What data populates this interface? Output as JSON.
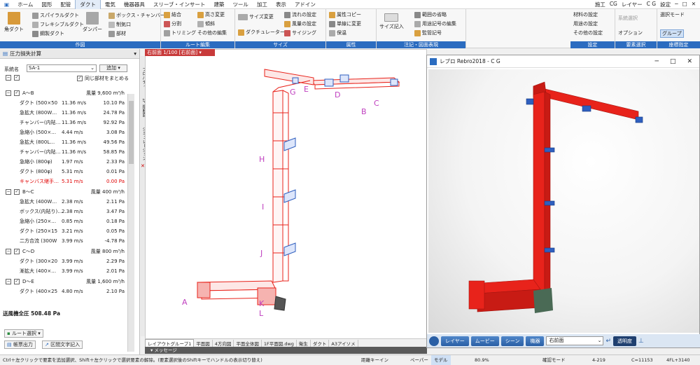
{
  "tabs": [
    "ホーム",
    "図形",
    "配管",
    "ダクト",
    "電気",
    "機器器具",
    "スリーブ・インサート",
    "建築",
    "ツール",
    "加工",
    "表示",
    "アドイン"
  ],
  "tabs_active": "ダクト",
  "tabs_right": [
    "施工",
    "CG",
    "レイヤー",
    "C G",
    "設定"
  ],
  "ribbon": {
    "groups": [
      {
        "caption": "作図",
        "items": [
          "角ダクト",
          "スパイラルダクト",
          "フレキシブルダクト",
          "鋼製ダクト",
          "ダンパー",
          "ボックス・チャンバー",
          "制気口",
          "部材"
        ]
      },
      {
        "caption": "ルート編集",
        "items": [
          "結合",
          "分割",
          "トリミング",
          "高さ変更",
          "傾斜",
          "その他の編集"
        ]
      },
      {
        "caption": "サイズ",
        "items": [
          "サイズ変更",
          "ダクチュレーター",
          "流れの設定",
          "風量の設定",
          "サイジング"
        ]
      },
      {
        "caption": "属性",
        "items": [
          "属性コピー",
          "単線に変更",
          "保温"
        ]
      },
      {
        "caption": "注記・図面表現",
        "items": [
          "サイズ記入",
          "範囲の省略",
          "用途記号の編集",
          "監管記号"
        ]
      },
      {
        "caption": "設定",
        "items": [
          "材料の設定",
          "用途の設定",
          "その他の設定"
        ]
      },
      {
        "caption": "要素選択",
        "items": [
          "系統選択",
          "オプション"
        ]
      },
      {
        "caption": "座標指定",
        "items": [
          "選択モード",
          "グループ"
        ]
      }
    ]
  },
  "panel": {
    "title": "圧力損失計算",
    "system_label": "系統名",
    "system_value": "SA-1",
    "add_button": "追加",
    "merge_label": "同じ部材をまとめる",
    "groups": [
      {
        "title": "A～B",
        "flow": "風量 9,600 m³/h",
        "rows": [
          [
            "ダクト (500×50",
            "11.36 m/s",
            "10.10 Pa",
            ""
          ],
          [
            "急拡大 (800W…",
            "11.36 m/s",
            "24.78 Pa",
            ""
          ],
          [
            "チャンバー(内貼…",
            "11.36 m/s",
            "92.92 Pa",
            ""
          ],
          [
            "急縮小 (500×…",
            "4.44 m/s",
            "3.08 Pa",
            ""
          ],
          [
            "急拡大 (800L…",
            "11.36 m/s",
            "49.56 Pa",
            ""
          ],
          [
            "チャンバー(内貼…",
            "11.36 m/s",
            "58.85 Pa",
            ""
          ],
          [
            "急縮小 (800φ)",
            "1.97 m/s",
            "2.33 Pa",
            ""
          ],
          [
            "ダクト (800φ)",
            "5.31 m/s",
            "0.01 Pa",
            ""
          ],
          [
            "キャンバス継手…",
            "5.31 m/s",
            "0.00 Pa",
            "red"
          ]
        ]
      },
      {
        "title": "B～C",
        "flow": "風量 400 m³/h",
        "rows": [
          [
            "急拡大 (400W…",
            "2.38 m/s",
            "2.11 Pa",
            ""
          ],
          [
            "ボックス(内貼り)…",
            "2.38 m/s",
            "3.47 Pa",
            ""
          ],
          [
            "急縮小 (250×…",
            "0.85 m/s",
            "0.18 Pa",
            ""
          ],
          [
            "ダクト (250×15",
            "3.21 m/s",
            "0.05 Pa",
            ""
          ],
          [
            "二方合流 (300W",
            "3.99 m/s",
            "-4.78 Pa",
            ""
          ]
        ]
      },
      {
        "title": "C～D",
        "flow": "風量 800 m³/h",
        "rows": [
          [
            "ダクト (300×20",
            "3.99 m/s",
            "2.29 Pa",
            ""
          ],
          [
            "漸拡大 (400×…",
            "3.99 m/s",
            "2.01 Pa",
            ""
          ]
        ]
      },
      {
        "title": "D～E",
        "flow": "風量 1,600 m³/h",
        "rows": [
          [
            "ダクト (400×25",
            "4.80 m/s",
            "2.10 Pa",
            ""
          ]
        ]
      }
    ],
    "total": "送風機全圧 508.48 Pa",
    "route_select": "ルート選択",
    "report_button": "帳票出力",
    "section_text_button": "区間文字記入"
  },
  "viewport": {
    "tab_label": "右前面 1/100 [右前面]",
    "side_tabs": [
      "プロパティ",
      "1F 縦断面",
      "ジミュレーション"
    ],
    "labels": [
      "A",
      "B",
      "C",
      "D",
      "E",
      "G",
      "H",
      "I",
      "J",
      "K",
      "L"
    ],
    "bottom_tabs": [
      "レイアウトグループ1",
      "平面図",
      "4方向図",
      "平面全体図",
      "1F平面図.dwg",
      "衛生",
      "ダクト",
      "A3アイソメ"
    ],
    "message_label": "メッセージ"
  },
  "rebro": {
    "title": "レブロ Rebro2018 - C G",
    "buttons": [
      "レイヤー",
      "ムービー",
      "シーン",
      "機器"
    ],
    "view_select": "右前面",
    "transparency": "透明度"
  },
  "status": {
    "hint": "Ctrl＋左クリックで要素を追加選択、Shift＋左クリックで選択要素の解除。(要素選択後のShiftキーでハンドルの表示切り替え)",
    "distance_key": "距離キーイン",
    "paper": "ペーパー",
    "model": "モデル",
    "zoom": "80.9%",
    "confirm_mode": "確認モード",
    "coord1": "4-219",
    "coord2": "C=11153",
    "floor": "4FL+3140"
  },
  "colors": {
    "duct_red": "#e8231b",
    "diffuser_blue": "#2f5fbf",
    "accent": "#2b6cc0",
    "label_magenta": "#c040c0"
  }
}
